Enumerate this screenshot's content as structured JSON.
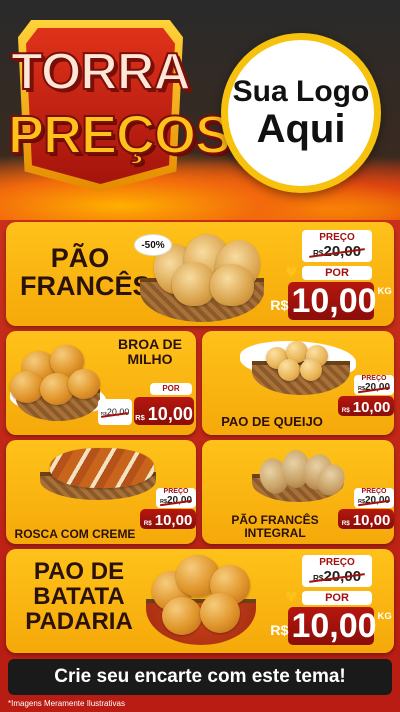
{
  "header": {
    "badge_line1": "TORRA",
    "badge_line2": "PREÇOS",
    "logo_line1": "Sua Logo",
    "logo_line2": "Aqui"
  },
  "colors": {
    "card": "#ffc21a",
    "price_red": "#a3110f",
    "background": "#b81c12"
  },
  "products": {
    "pao_frances": {
      "title_line1": "PÃO",
      "title_line2": "FRANCÊS",
      "discount": "-50%",
      "preco_label": "PREÇO",
      "old_currency": "R$",
      "old_price": "20,00",
      "por_label": "POR",
      "currency": "R$",
      "price": "10,00",
      "unit": "KG"
    },
    "broa": {
      "title_line1": "BROA DE",
      "title_line2": "MILHO",
      "por_label": "POR",
      "old_currency": "R$",
      "old_price": "20,00",
      "currency": "R$",
      "price": "10,00"
    },
    "pao_queijo": {
      "title": "PAO DE QUEIJO",
      "preco_label": "PREÇO",
      "old_currency": "R$",
      "old_price": "20,00",
      "currency": "R$",
      "price": "10,00"
    },
    "rosca": {
      "title": "ROSCA COM CREME",
      "preco_label": "PREÇO",
      "old_currency": "R$",
      "old_price": "20,00",
      "currency": "R$",
      "price": "10,00"
    },
    "frances_integral": {
      "title_line1": "PÃO FRANCÊS",
      "title_line2": "INTEGRAL",
      "preco_label": "PREÇO",
      "old_currency": "R$",
      "old_price": "20,00",
      "currency": "R$",
      "price": "10,00"
    },
    "batata": {
      "title_line1": "PAO DE",
      "title_line2": "BATATA",
      "title_line3": "PADARIA",
      "preco_label": "PREÇO",
      "old_currency": "R$",
      "old_price": "20,00",
      "por_label": "POR",
      "currency": "R$",
      "price": "10,00",
      "unit": "KG"
    }
  },
  "cta": "Crie seu encarte com este tema!",
  "disclaimer": "*Imagens Meramente Ilustrativas"
}
